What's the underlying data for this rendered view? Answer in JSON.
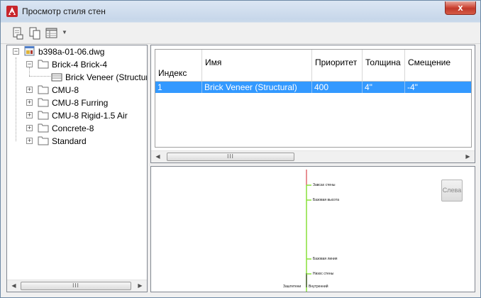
{
  "window": {
    "title": "Просмотр стиля стен",
    "close_glyph": "x"
  },
  "toolbar": {
    "icons": [
      "open-drawing-icon",
      "copy-icon",
      "table-view-icon",
      "dropdown-arrow-icon"
    ]
  },
  "tree": {
    "root": {
      "label": "b398a-01-06.dwg",
      "expander": "−"
    },
    "items": [
      {
        "label": "Brick-4 Brick-4",
        "expander": "−"
      },
      {
        "label": "Brick Veneer (Structural)"
      },
      {
        "label": "CMU-8",
        "expander": "+"
      },
      {
        "label": "CMU-8 Furring",
        "expander": "+"
      },
      {
        "label": "CMU-8 Rigid-1.5 Air",
        "expander": "+"
      },
      {
        "label": "Concrete-8",
        "expander": "+"
      },
      {
        "label": "Standard",
        "expander": "+"
      }
    ]
  },
  "table": {
    "columns": [
      "Индекс",
      "Имя",
      "Приоритет",
      "Толщина",
      "Смещение"
    ],
    "rows": [
      [
        "1",
        "Brick Veneer (Structural)",
        "400",
        "4\"",
        "-4\""
      ]
    ]
  },
  "scrollbar": {
    "left_arrow": "◀",
    "right_arrow": "▶",
    "grip": "III"
  },
  "preview": {
    "button_label": "Слева",
    "labels": {
      "top": "Завсах стены",
      "upper": "Базовая высота",
      "lower": "Базовая линия",
      "bottom": "Низос стены",
      "bottom_left": "Заштетени",
      "bottom_right": "Внутренний"
    },
    "colors": {
      "line": "#88e03a",
      "axis": "#d0202a"
    }
  }
}
